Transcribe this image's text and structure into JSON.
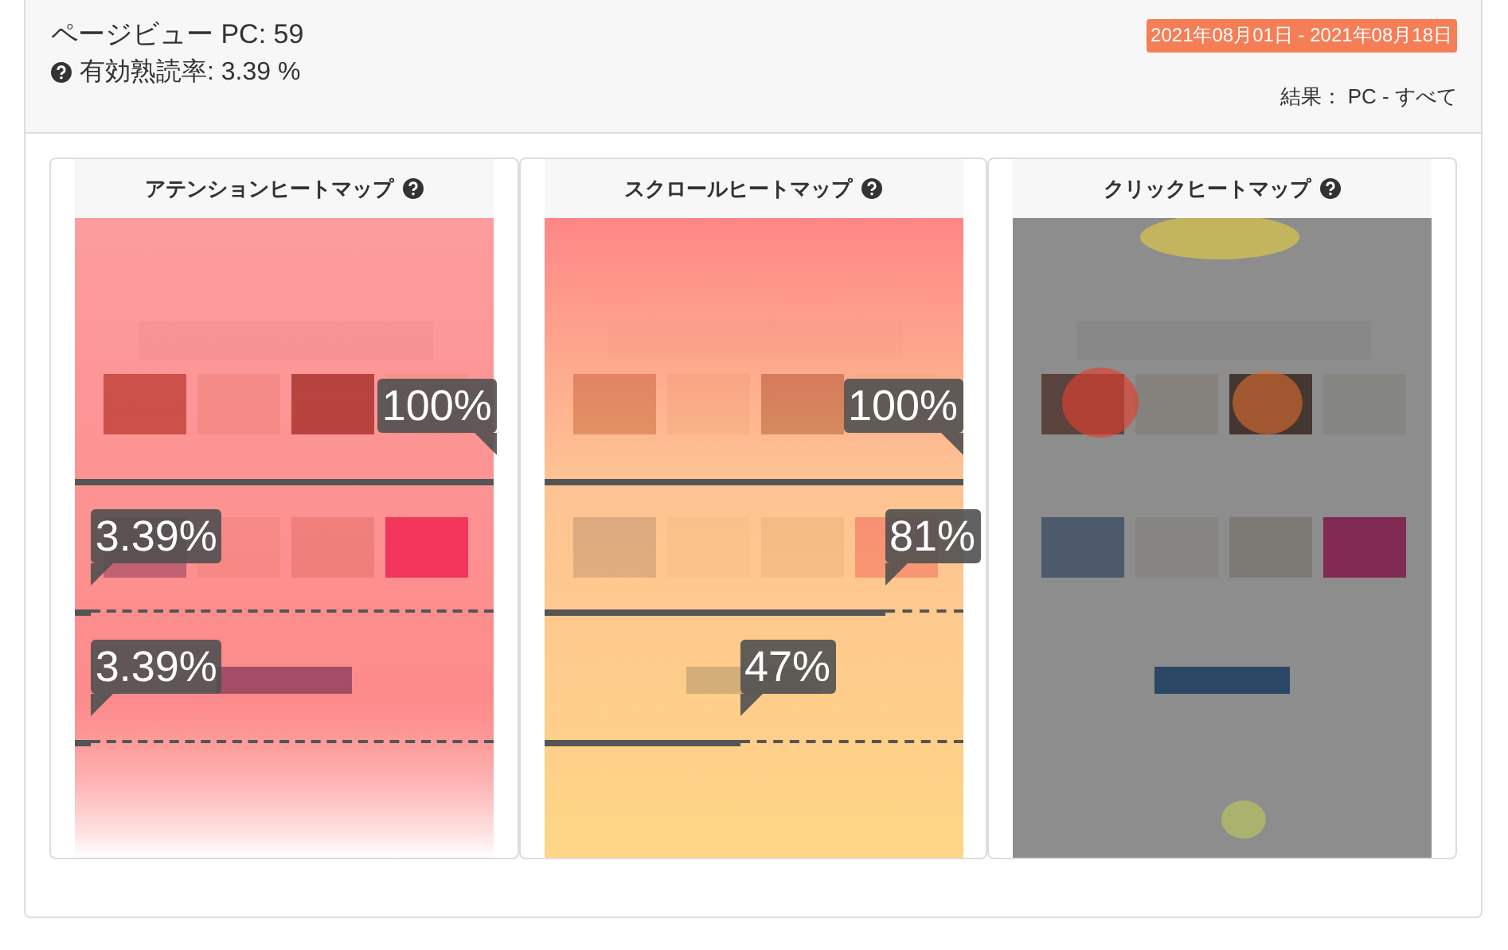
{
  "summary": {
    "pageviews": "ページビュー PC: 59",
    "read_rate": "有効熟読率: 3.39 %",
    "date_range": "2021年08月01日 - 2021年08月18日",
    "result": "結果： PC - すべて"
  },
  "heatmaps": [
    {
      "kind": "attention",
      "title": "アテンションヒートマップ",
      "markers": [
        {
          "label": "100%"
        },
        {
          "label": "3.39%"
        },
        {
          "label": "3.39%"
        }
      ]
    },
    {
      "kind": "scroll",
      "title": "スクロールヒートマップ",
      "markers": [
        {
          "label": "100%"
        },
        {
          "label": "81%"
        },
        {
          "label": "47%"
        }
      ]
    },
    {
      "kind": "click",
      "title": "クリックヒートマップ"
    }
  ]
}
